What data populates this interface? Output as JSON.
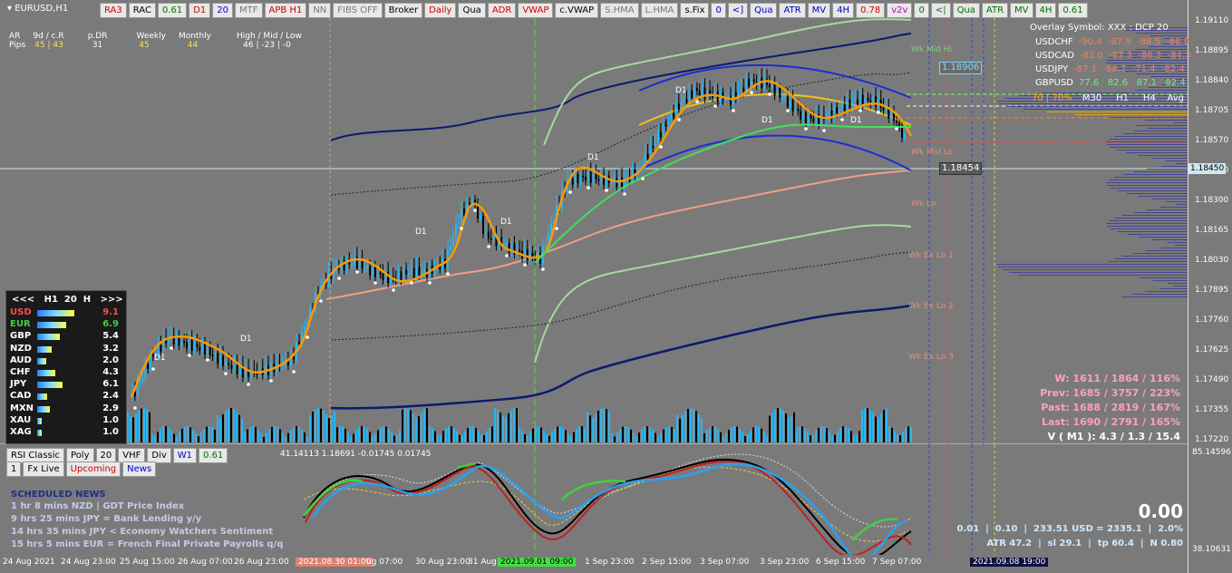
{
  "chart": {
    "title": "EURUSD,H1"
  },
  "toolbar": [
    {
      "label": "RA3",
      "color": "red"
    },
    {
      "label": "RAC",
      "color": ""
    },
    {
      "label": "0.61",
      "color": "green"
    },
    {
      "label": "D1",
      "color": "red"
    },
    {
      "label": "20",
      "color": "blue"
    },
    {
      "label": "MTF",
      "color": "gray"
    },
    {
      "label": "APB H1",
      "color": "red"
    },
    {
      "label": "NN",
      "color": "gray"
    },
    {
      "label": "FIBS OFF",
      "color": "gray"
    },
    {
      "label": "Broker",
      "color": ""
    },
    {
      "label": "Daily",
      "color": "red"
    },
    {
      "label": "Qua",
      "color": ""
    },
    {
      "label": "ADR",
      "color": "red"
    },
    {
      "label": "VWAP",
      "color": "red"
    },
    {
      "label": "c.VWAP",
      "color": ""
    },
    {
      "label": "S.HMA",
      "color": "gray"
    },
    {
      "label": "L.HMA",
      "color": "gray"
    },
    {
      "label": "s.Fix",
      "color": ""
    },
    {
      "label": "0",
      "color": "blue"
    },
    {
      "label": "<]",
      "color": "blue"
    },
    {
      "label": "Qua",
      "color": "blue"
    },
    {
      "label": "ATR",
      "color": "blue"
    },
    {
      "label": "MV",
      "color": "blue"
    },
    {
      "label": "4H",
      "color": "blue"
    },
    {
      "label": "0.78",
      "color": "red"
    },
    {
      "label": "v2v",
      "color": "magenta"
    },
    {
      "label": "0",
      "color": "green"
    },
    {
      "label": "<|",
      "color": "green"
    },
    {
      "label": "Qua",
      "color": "green"
    },
    {
      "label": "ATR",
      "color": "green"
    },
    {
      "label": "MV",
      "color": "green"
    },
    {
      "label": "4H",
      "color": "green"
    },
    {
      "label": "0.61",
      "color": "green"
    }
  ],
  "info": {
    "headers": [
      "AR",
      "9d / c.R",
      "p.DR",
      "Weekly",
      "Monthly",
      "High / Mid / Low"
    ],
    "row_label": "Pips",
    "values": [
      "45 | 43",
      "31",
      "45",
      "44",
      "46 | -23 | -0"
    ]
  },
  "overlay": {
    "title": "Overlay Symbol: XXX : DCP 20",
    "rows": [
      {
        "sym": "USDCHF",
        "vals": "-90.4  -87.9  -88.5  -88.9"
      },
      {
        "sym": "USDCAD",
        "vals": "-83.0  -83.3  -86.3  -84.3"
      },
      {
        "sym": "USDJPY",
        "vals": "-87.1  -88.7  -71.4  -82.4"
      },
      {
        "sym": "GBPUSD",
        "vals": "77.6   82.6   87.1   82.4"
      }
    ],
    "footer_pct": "70 | 70%",
    "footer_cols": "M30     H1     H4    Avg"
  },
  "price_axis": [
    "1.19110",
    "1.18895",
    "1.18840",
    "1.18705",
    "1.18570",
    "1.18450",
    "1.18300",
    "1.18165",
    "1.18030",
    "1.17895",
    "1.17760",
    "1.17625",
    "1.17490",
    "1.17355",
    "1.17220"
  ],
  "price_boxes": {
    "upper": "1.18906",
    "lower": "1.18454",
    "current": "1.18450"
  },
  "level_labels": [
    "Wk Mid Hi",
    "Wk Mid Lo",
    "Wk Lo",
    "Wk Ex Lo 1",
    "Wk Ex Lo 2",
    "Wk Ex Lo 3"
  ],
  "d1_label": "D1",
  "currency_panel": {
    "header": "<<<   H1  20  H   >>>",
    "rows": [
      {
        "name": "USD",
        "value": "9.1",
        "bar": 0.9,
        "color": "#ff4a4a"
      },
      {
        "name": "EUR",
        "value": "6.9",
        "bar": 0.7,
        "color": "#40d040"
      },
      {
        "name": "GBP",
        "value": "5.4",
        "bar": 0.55,
        "color": "#ffffff"
      },
      {
        "name": "NZD",
        "value": "3.2",
        "bar": 0.35,
        "color": "#ffffff"
      },
      {
        "name": "AUD",
        "value": "2.0",
        "bar": 0.22,
        "color": "#ffffff"
      },
      {
        "name": "CHF",
        "value": "4.3",
        "bar": 0.45,
        "color": "#ffffff"
      },
      {
        "name": "JPY",
        "value": "6.1",
        "bar": 0.62,
        "color": "#ffffff"
      },
      {
        "name": "CAD",
        "value": "2.4",
        "bar": 0.25,
        "color": "#ffffff"
      },
      {
        "name": "MXN",
        "value": "2.9",
        "bar": 0.3,
        "color": "#ffffff"
      },
      {
        "name": "XAU",
        "value": "1.0",
        "bar": 0.1,
        "color": "#ffffff"
      },
      {
        "name": "XAG",
        "value": "1.0",
        "bar": 0.1,
        "color": "#ffffff"
      }
    ]
  },
  "stats": {
    "w": "W: 1611 / 1864 / 116%",
    "prev": "Prev: 1685 / 3757 / 223%",
    "past": "Past: 1688 / 2819 / 167%",
    "last": "Last: 1690 / 2791 / 165%",
    "v": "V ( M1 ): 4.3 / 1.3 / 15.4"
  },
  "sub_toolbar": [
    "RSI Classic",
    "Poly",
    "20",
    "VHF",
    "Div",
    "W1",
    "0.61"
  ],
  "sub_values": "41.14113  1.18691  -0.01745  0.01745",
  "news_tabs": [
    "1",
    "Fx Live",
    "Upcoming",
    "News"
  ],
  "news": {
    "title": "SCHEDULED NEWS",
    "items": [
      "1 hr 8 mins  NZD  |  GDT Price Index",
      "9 hrs 25 mins  JPY  =  Bank Lending y/y",
      "14 hrs 35 mins  JPY  <  Economy Watchers Sentiment",
      "15 hrs 5 mins  EUR  =  French Final Private Payrolls q/q"
    ]
  },
  "bottom_right": {
    "big": "0.00",
    "line1": "0.01  |  0.10  |  233.51 USD = 2335.1  |  2.0%",
    "line2": "ATR 47.2  |  sl 29.1  |  tp 60.4  |  N 0.80"
  },
  "sub_axis": {
    "top": "85.14596",
    "bottom": "38.10631"
  },
  "time_axis": [
    "24 Aug 2021",
    "24 Aug 23:00",
    "25 Aug 15:00",
    "26 Aug 07:00",
    "26 Aug 23:00",
    "2021.08.30 01:00",
    "ug 07:00",
    "30 Aug 23:00",
    "31 Aug",
    "2021.09.01 09:00",
    "1 Sep 23:00",
    "2 Sep 15:00",
    "3 Sep 07:00",
    "3 Sep 23:00",
    "6 Sep 15:00",
    "7 Sep 07:00",
    "2021.09.08 19:00"
  ],
  "colors": {
    "bg": "#7a7a7a",
    "candle_up": "#29b6f6",
    "candle_down": "#000000",
    "band_outer": "#0b1a6e",
    "band_green": "#a8d8a0",
    "ema_orange": "#ff9800",
    "ema_salmon": "#f0a080"
  }
}
